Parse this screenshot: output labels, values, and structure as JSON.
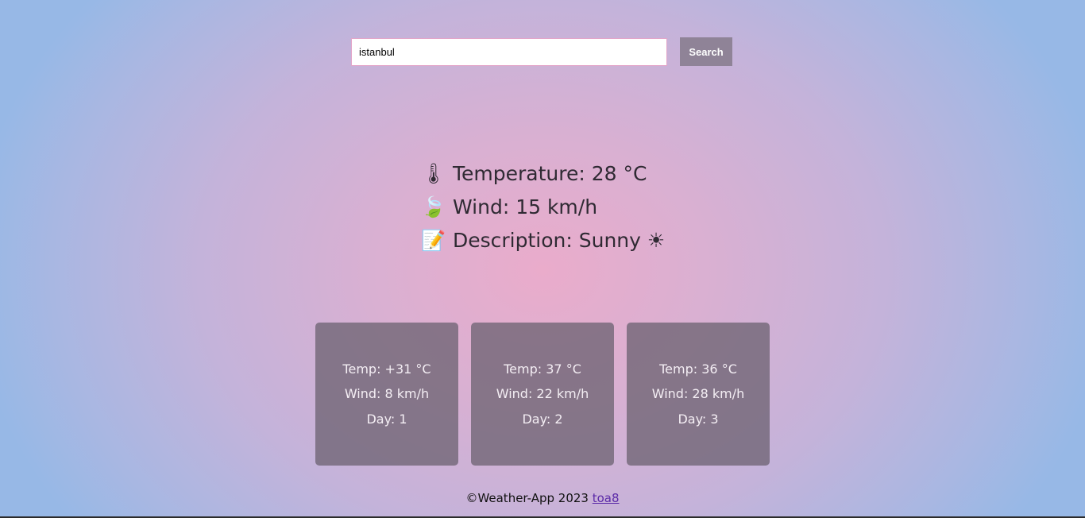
{
  "search": {
    "value": "istanbul",
    "button_label": "Search"
  },
  "current": {
    "temperature": "Temperature: 28 °C",
    "temperature_icon": "🌡",
    "wind": "Wind: 15 km/h",
    "wind_icon": "🍃",
    "description": "Description: Sunny ☀",
    "description_icon": "📝"
  },
  "forecast": [
    {
      "temp": "Temp: +31 °C",
      "wind": "Wind: 8 km/h",
      "day": "Day: 1"
    },
    {
      "temp": "Temp: 37 °C",
      "wind": "Wind: 22 km/h",
      "day": "Day: 2"
    },
    {
      "temp": "Temp: 36 °C",
      "wind": "Wind: 28 km/h",
      "day": "Day: 3"
    }
  ],
  "footer": {
    "text": "©Weather-App 2023",
    "link_text": "toa8"
  }
}
